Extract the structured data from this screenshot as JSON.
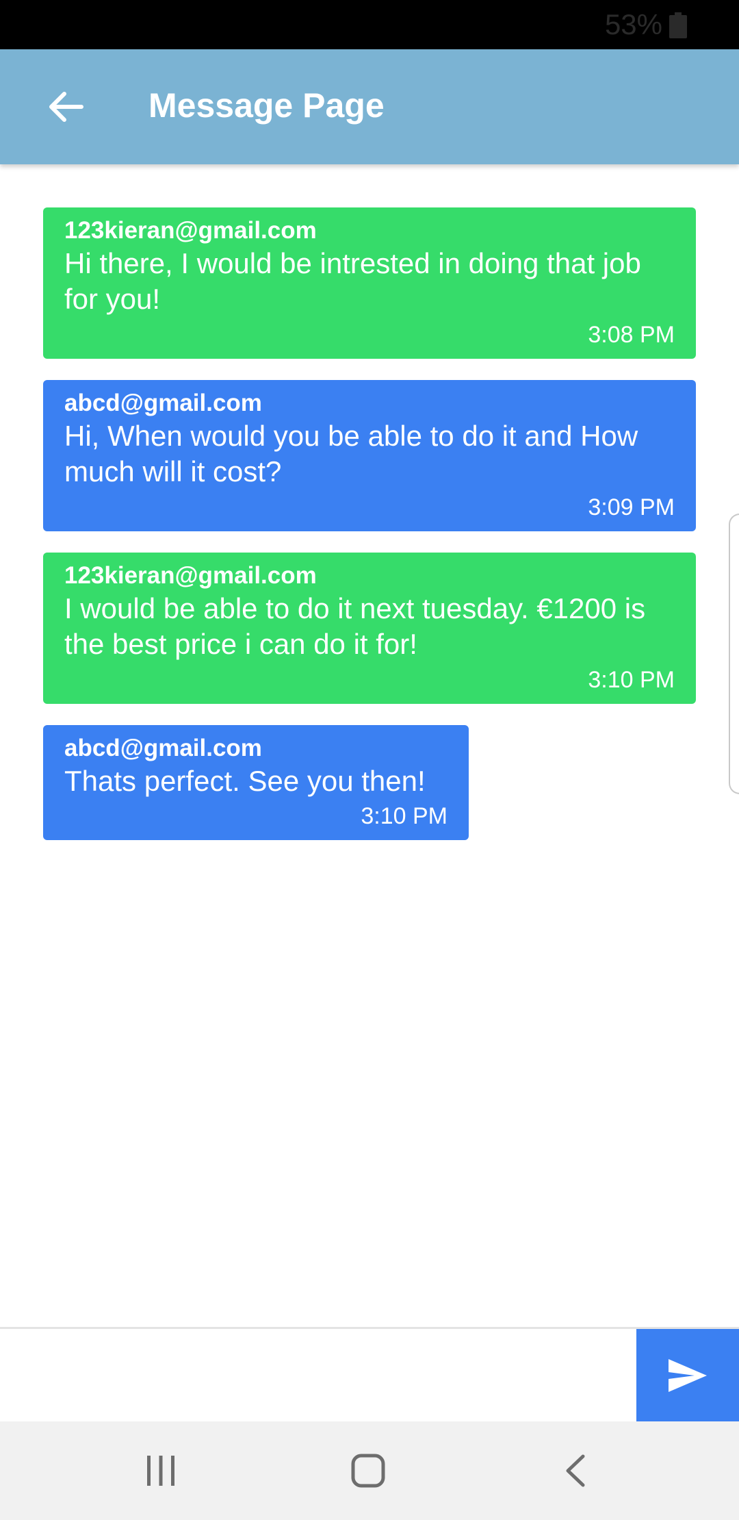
{
  "status_bar": {
    "battery_percent": "53%",
    "battery_icon": "battery-icon"
  },
  "app_bar": {
    "title": "Message Page",
    "back_icon": "arrow-left-icon",
    "background_color": "#7bb3d3"
  },
  "messages": [
    {
      "sender": "123kieran@gmail.com",
      "text": "Hi there, I would be intrested in doing that job for you!",
      "time": "3:08 PM",
      "color": "#36dc6a"
    },
    {
      "sender": "abcd@gmail.com",
      "text": "Hi, When would you be able to do it and How much will it cost?",
      "time": "3:09 PM",
      "color": "#3b80f2"
    },
    {
      "sender": "123kieran@gmail.com",
      "text": "I would be able to do it next tuesday. €1200 is the best price i can do it for!",
      "time": "3:10 PM",
      "color": "#36dc6a"
    },
    {
      "sender": "abcd@gmail.com",
      "text": "Thats perfect. See you then!",
      "time": "3:10 PM",
      "color": "#3b80f2"
    }
  ],
  "composer": {
    "value": "",
    "placeholder": "",
    "send_icon": "send-icon"
  },
  "nav_bar": {
    "recents_icon": "recents-icon",
    "home_icon": "home-icon",
    "back_icon": "back-chevron-icon"
  }
}
